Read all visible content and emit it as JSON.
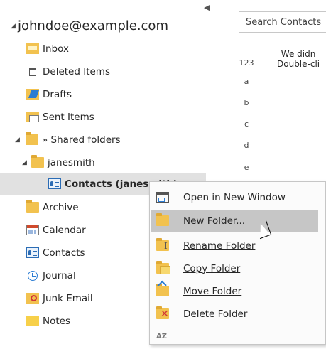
{
  "account": "johndoe@example.com",
  "folders": [
    {
      "label": "Inbox",
      "icon": "inbox-icon"
    },
    {
      "label": "Deleted Items",
      "icon": "trash-icon"
    },
    {
      "label": "Drafts",
      "icon": "drafts-icon"
    },
    {
      "label": "Sent Items",
      "icon": "sent-icon"
    },
    {
      "label": "» Shared folders",
      "icon": "folder-icon"
    },
    {
      "label": "janesmith",
      "icon": "folder-icon"
    },
    {
      "label": "Contacts (janesmith)",
      "icon": "contacts-icon"
    },
    {
      "label": "Archive",
      "icon": "folder-icon"
    },
    {
      "label": "Calendar",
      "icon": "calendar-icon"
    },
    {
      "label": "Contacts",
      "icon": "contacts-icon"
    },
    {
      "label": "Journal",
      "icon": "journal-icon"
    },
    {
      "label": "Junk Email",
      "icon": "junk-icon"
    },
    {
      "label": "Notes",
      "icon": "notes-icon"
    }
  ],
  "search": {
    "placeholder": "Search Contacts"
  },
  "alpha_index": [
    "123",
    "a",
    "b",
    "c",
    "d",
    "e"
  ],
  "empty_message": {
    "line1": "We didn",
    "line2": "Double-cli"
  },
  "context_menu": {
    "items": [
      {
        "label": "Open in New Window",
        "icon": "new-window-icon"
      },
      {
        "label": "New Folder...",
        "icon": "folder-icon"
      },
      {
        "label": "Rename Folder",
        "icon": "rename-icon"
      },
      {
        "label": "Copy Folder",
        "icon": "copy-folder-icon"
      },
      {
        "label": "Move Folder",
        "icon": "move-folder-icon"
      },
      {
        "label": "Delete Folder",
        "icon": "delete-icon"
      }
    ],
    "partial_next_icon": "AZ"
  },
  "colors": {
    "accent": "#2b7cd3",
    "folder": "#f2c24f",
    "selected": "#e1e1e1",
    "menu_hover": "#c6c6c6"
  }
}
